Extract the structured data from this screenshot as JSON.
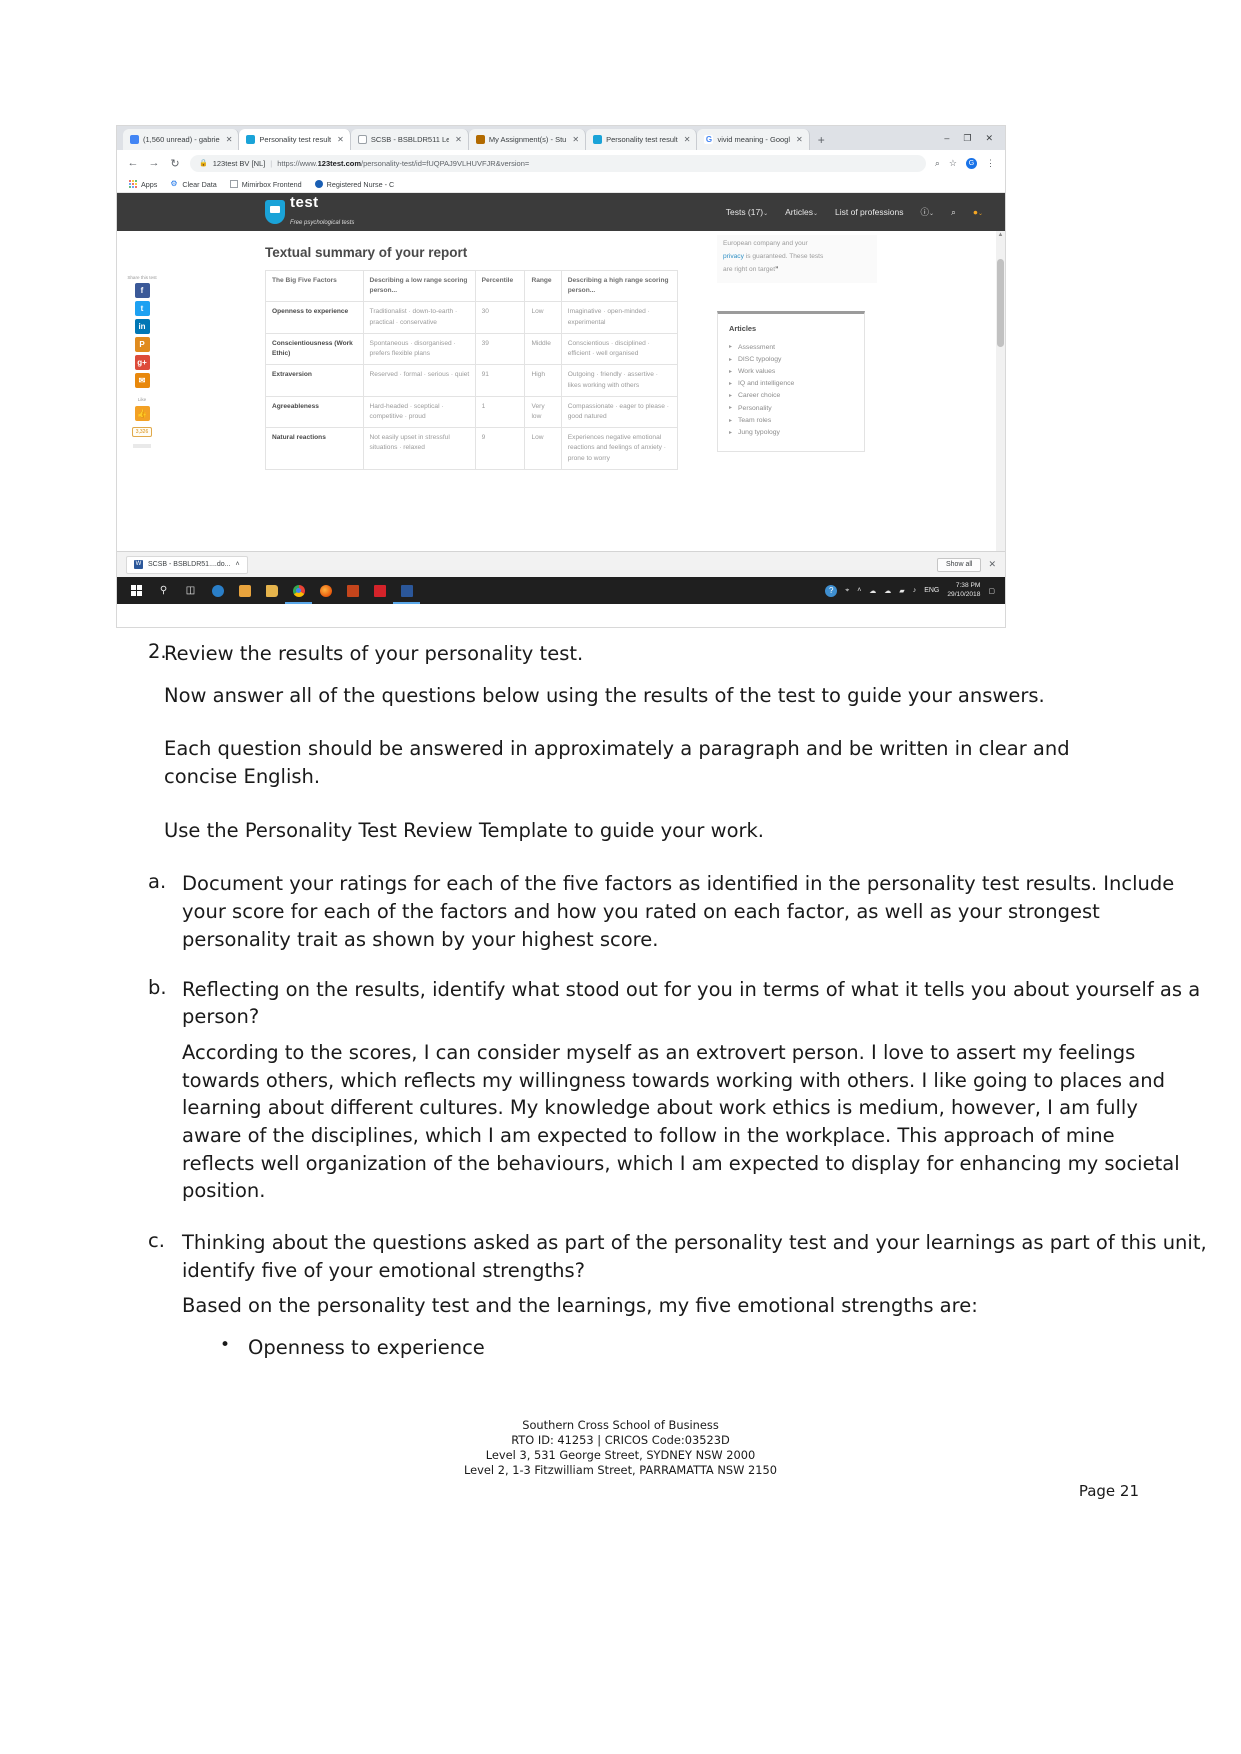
{
  "screenshot": {
    "browser": {
      "tabs": [
        {
          "label": "(1,560 unread) - gabrie",
          "icon": "mail-icon",
          "active": false
        },
        {
          "label": "Personality test result ",
          "icon": "123test-icon",
          "active": true
        },
        {
          "label": "SCSB - BSBLDR511 Lea",
          "icon": "document-icon",
          "active": false
        },
        {
          "label": "My Assignment(s) - Stu",
          "icon": "moodle-icon",
          "active": false
        },
        {
          "label": "Personality test result ",
          "icon": "123test-icon",
          "active": false
        },
        {
          "label": "vivid meaning - Googl",
          "icon": "google-icon",
          "active": false
        }
      ],
      "new_tab_label": "+",
      "window_controls": {
        "minimize": "–",
        "maximize": "❐",
        "close": "✕"
      },
      "nav": {
        "back": "←",
        "forward": "→",
        "reload": "↻"
      },
      "omnibox": {
        "lock_icon": "lock-icon",
        "site_identity": "123test BV [NL]",
        "url_prefix": "https://www.",
        "url_domain": "123test.com",
        "url_path": "/personality-test/id=fUQPAJ9VLHUVFJR&version="
      },
      "omnibox_icons": {
        "search": "⌕",
        "star": "☆",
        "avatar": "G",
        "menu": "⋮"
      },
      "bookmarks": [
        {
          "label": "Apps",
          "icon": "apps-grid-icon"
        },
        {
          "label": "Clear Data",
          "icon": "gear-icon"
        },
        {
          "label": "Mimirbox Frontend",
          "icon": "page-icon"
        },
        {
          "label": "Registered Nurse - C",
          "icon": "globe-icon"
        }
      ]
    },
    "site": {
      "logo": {
        "main": "test",
        "sub": "Free psychological tests"
      },
      "nav_links": [
        {
          "label": "Tests (17)",
          "caret": "⌄"
        },
        {
          "label": "Articles",
          "caret": "⌄"
        },
        {
          "label": "List of professions",
          "caret": ""
        },
        {
          "label": "ⓘ",
          "caret": "⌄"
        },
        {
          "label": "⌕",
          "caret": ""
        },
        {
          "label": "●",
          "caret": "⌄"
        }
      ],
      "share_rail": {
        "label": "Share this test",
        "buttons": [
          "f",
          "t",
          "in",
          "P",
          "g+",
          "✉"
        ],
        "like_label": "Like",
        "like_icon": "👍",
        "like_count": "3,326"
      },
      "heading": "Textual summary of your report",
      "table": {
        "headers": [
          "The Big Five Factors",
          "Describing a low range scoring person...",
          "Percentile",
          "Range",
          "Describing a high range scoring person..."
        ],
        "rows": [
          {
            "factor": "Openness to experience",
            "low": "Traditionalist · down-to-earth · practical · conservative",
            "percentile": "30",
            "range": "Low",
            "high": "Imaginative · open-minded · experimental"
          },
          {
            "factor": "Conscientiousness (Work Ethic)",
            "low": "Spontaneous · disorganised · prefers flexible plans",
            "percentile": "39",
            "range": "Middle",
            "high": "Conscientious · disciplined · efficient · well organised"
          },
          {
            "factor": "Extraversion",
            "low": "Reserved · formal · serious · quiet",
            "percentile": "91",
            "range": "High",
            "high": "Outgoing · friendly · assertive · likes working with others"
          },
          {
            "factor": "Agreeableness",
            "low": "Hard-headed · sceptical · competitive · proud",
            "percentile": "1",
            "range": "Very low",
            "high": "Compassionate · eager to please · good natured"
          },
          {
            "factor": "Natural reactions",
            "low": "Not easily upset in stressful situations · relaxed",
            "percentile": "9",
            "range": "Low",
            "high": "Experiences negative emotional reactions and feelings of anxiety · prone to worry"
          }
        ]
      },
      "blurb": {
        "line1": "European company and your",
        "link": "privacy",
        "line2": " is guaranteed. These tests",
        "line3": "are right on target",
        "quote_mark": "”"
      },
      "articles_panel": {
        "title": "Articles",
        "items": [
          "Assessment",
          "DISC typology",
          "Work values",
          "IQ and intelligence",
          "Career choice",
          "Personality",
          "Team roles",
          "Jung typology"
        ]
      }
    },
    "downloads_bar": {
      "file_label": "SCSB - BSBLDR51....do...",
      "file_icon": "word-doc-icon",
      "caret": "˄",
      "show_all_label": "Show all",
      "close_icon": "✕"
    },
    "taskbar": {
      "items": [
        "windows-start-icon",
        "search-icon",
        "task-view-icon",
        "edge-icon",
        "store-icon",
        "file-explorer-icon",
        "chrome-icon",
        "firefox-icon",
        "powerpoint-icon",
        "acrobat-icon",
        "word-icon"
      ],
      "tray": {
        "help_icon": "?",
        "pin_icon": "⌖",
        "chevron_icon": "˄",
        "cloud_icon": "☁",
        "onedrive_icon": "☁",
        "network_icon": "▰",
        "volume_icon": "♪",
        "language": "ENG",
        "time": "7:38 PM",
        "date": "29/10/2018",
        "notifications_icon": "▢"
      }
    }
  },
  "document": {
    "item2": {
      "marker": "2.",
      "lead": "Review the results of your personality test.",
      "sub1": "Now answer all of the questions below using the results of the test to guide your answers.",
      "sub2": "Each question should be answered in approximately a paragraph and be written in clear and concise English.",
      "sub3": "Use the Personality Test Review Template to guide your work."
    },
    "item_a": {
      "marker": "a.",
      "question": "Document your ratings for each of the five factors as identified in the personality test results. Include your score for each of the factors and how you rated on each factor, as well as your strongest personality trait as shown by your highest score."
    },
    "item_b": {
      "marker": "b.",
      "question": "Reflecting on the results, identify what stood out for you in terms of what it tells you about yourself as a person?",
      "answer": "According to the scores, I can consider myself as an extrovert person. I love to assert my feelings towards others, which reflects my willingness towards working with others. I like going to places and learning about different cultures. My knowledge about work ethics is medium, however, I am fully aware of the disciplines, which I am expected to follow in the workplace. This approach of mine reflects well organization of the behaviours, which I am expected to display for enhancing my societal position."
    },
    "item_c": {
      "marker": "c.",
      "question": "Thinking about the questions asked as part of the personality test and your learnings as part of this unit, identify five of your emotional strengths?",
      "answer": "Based on the personality test and the learnings, my five emotional strengths are:",
      "bullets": [
        "Openness to experience"
      ]
    }
  },
  "footer": {
    "line1": "Southern Cross School of Business",
    "line2": "RTO ID: 41253 | CRICOS Code:03523D",
    "line3": "Level 3, 531 George Street, SYDNEY NSW 2000",
    "line4": "Level 2, 1-3 Fitzwilliam Street, PARRAMATTA NSW 2150",
    "page_number": "Page 21"
  }
}
